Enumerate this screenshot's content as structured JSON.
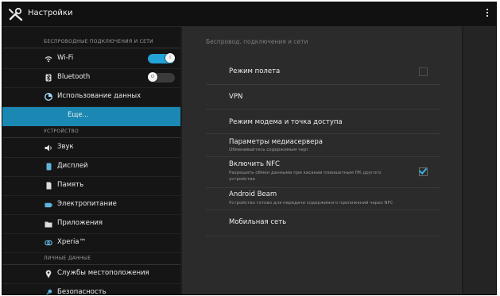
{
  "app": {
    "title": "Настройки"
  },
  "sidebar": {
    "sections": [
      {
        "label": "БЕСПРОВОДНЫЕ ПОДКЛЮЧЕНИЯ И СЕТИ"
      },
      {
        "label": "УСТРОЙСТВО"
      },
      {
        "label": "ЛИЧНЫЕ ДАННЫЕ"
      }
    ],
    "items": [
      {
        "label": "Wi-Fi",
        "icon": "wifi-icon",
        "toggle": "on"
      },
      {
        "label": "Bluetooth",
        "icon": "bluetooth-icon",
        "toggle": "off"
      },
      {
        "label": "Использование данных",
        "icon": "data-usage-icon"
      },
      {
        "label": "Еще...",
        "selected": true
      },
      {
        "label": "Звук",
        "icon": "sound-icon"
      },
      {
        "label": "Дисплей",
        "icon": "display-icon"
      },
      {
        "label": "Память",
        "icon": "storage-icon"
      },
      {
        "label": "Электропитание",
        "icon": "battery-icon"
      },
      {
        "label": "Приложения",
        "icon": "apps-icon"
      },
      {
        "label": "Xperia™",
        "icon": "xperia-icon"
      },
      {
        "label": "Службы местоположения",
        "icon": "location-icon"
      },
      {
        "label": "Безопасность",
        "icon": "security-icon"
      }
    ]
  },
  "content": {
    "header": "Беспровод. подключения и сети",
    "rows": [
      {
        "title": "Режим полета",
        "checkbox": false
      },
      {
        "title": "VPN"
      },
      {
        "title": "Режим модема и точка доступа"
      },
      {
        "title": "Параметры медиасервера",
        "subtitle": "Обменивайтесь содержимым черг"
      },
      {
        "title": "Включить NFC",
        "subtitle": "Разрешить обмен данными при касании планшетным ПК другого устройства",
        "checkbox": true
      },
      {
        "title": "Android Beam",
        "subtitle": "Устройство готово для передачи содержимого приложений через NFC"
      },
      {
        "title": "Мобильная сеть"
      }
    ]
  },
  "colors": {
    "accent": "#1b88b4",
    "toggle_on": "#23a3d6",
    "check": "#33b5e5"
  }
}
